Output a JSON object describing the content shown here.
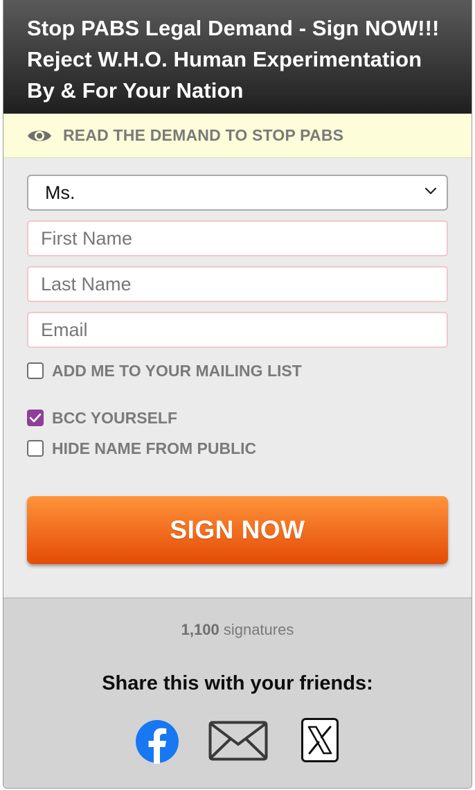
{
  "header": {
    "title": "Stop PABS Legal Demand - Sign NOW!!! Reject W.H.O. Human Experimentation By & For Your Nation"
  },
  "read_demand": {
    "label": "READ THE DEMAND TO STOP PABS",
    "icon": "eye-icon"
  },
  "form": {
    "salutation": {
      "selected": "Ms."
    },
    "first_name": {
      "placeholder": "First Name",
      "value": ""
    },
    "last_name": {
      "placeholder": "Last Name",
      "value": ""
    },
    "email": {
      "placeholder": "Email",
      "value": ""
    },
    "checkboxes": [
      {
        "label": "ADD ME TO YOUR MAILING LIST",
        "checked": false
      },
      {
        "label": "BCC YOURSELF",
        "checked": true
      },
      {
        "label": "HIDE NAME FROM PUBLIC",
        "checked": false
      }
    ],
    "submit_label": "SIGN NOW"
  },
  "footer": {
    "signature_count": "1,100",
    "signature_suffix": " signatures",
    "share_title": "Share this with your friends:",
    "share_icons": [
      "facebook-icon",
      "email-icon",
      "x-icon"
    ]
  },
  "colors": {
    "header_dark": "#1f1f1f",
    "read_bar_bg": "#fdfdd9",
    "checkbox_accent": "#8e3f98",
    "button_orange_top": "#ff933a",
    "button_orange_bottom": "#e44b06",
    "facebook_blue": "#1877f2"
  }
}
